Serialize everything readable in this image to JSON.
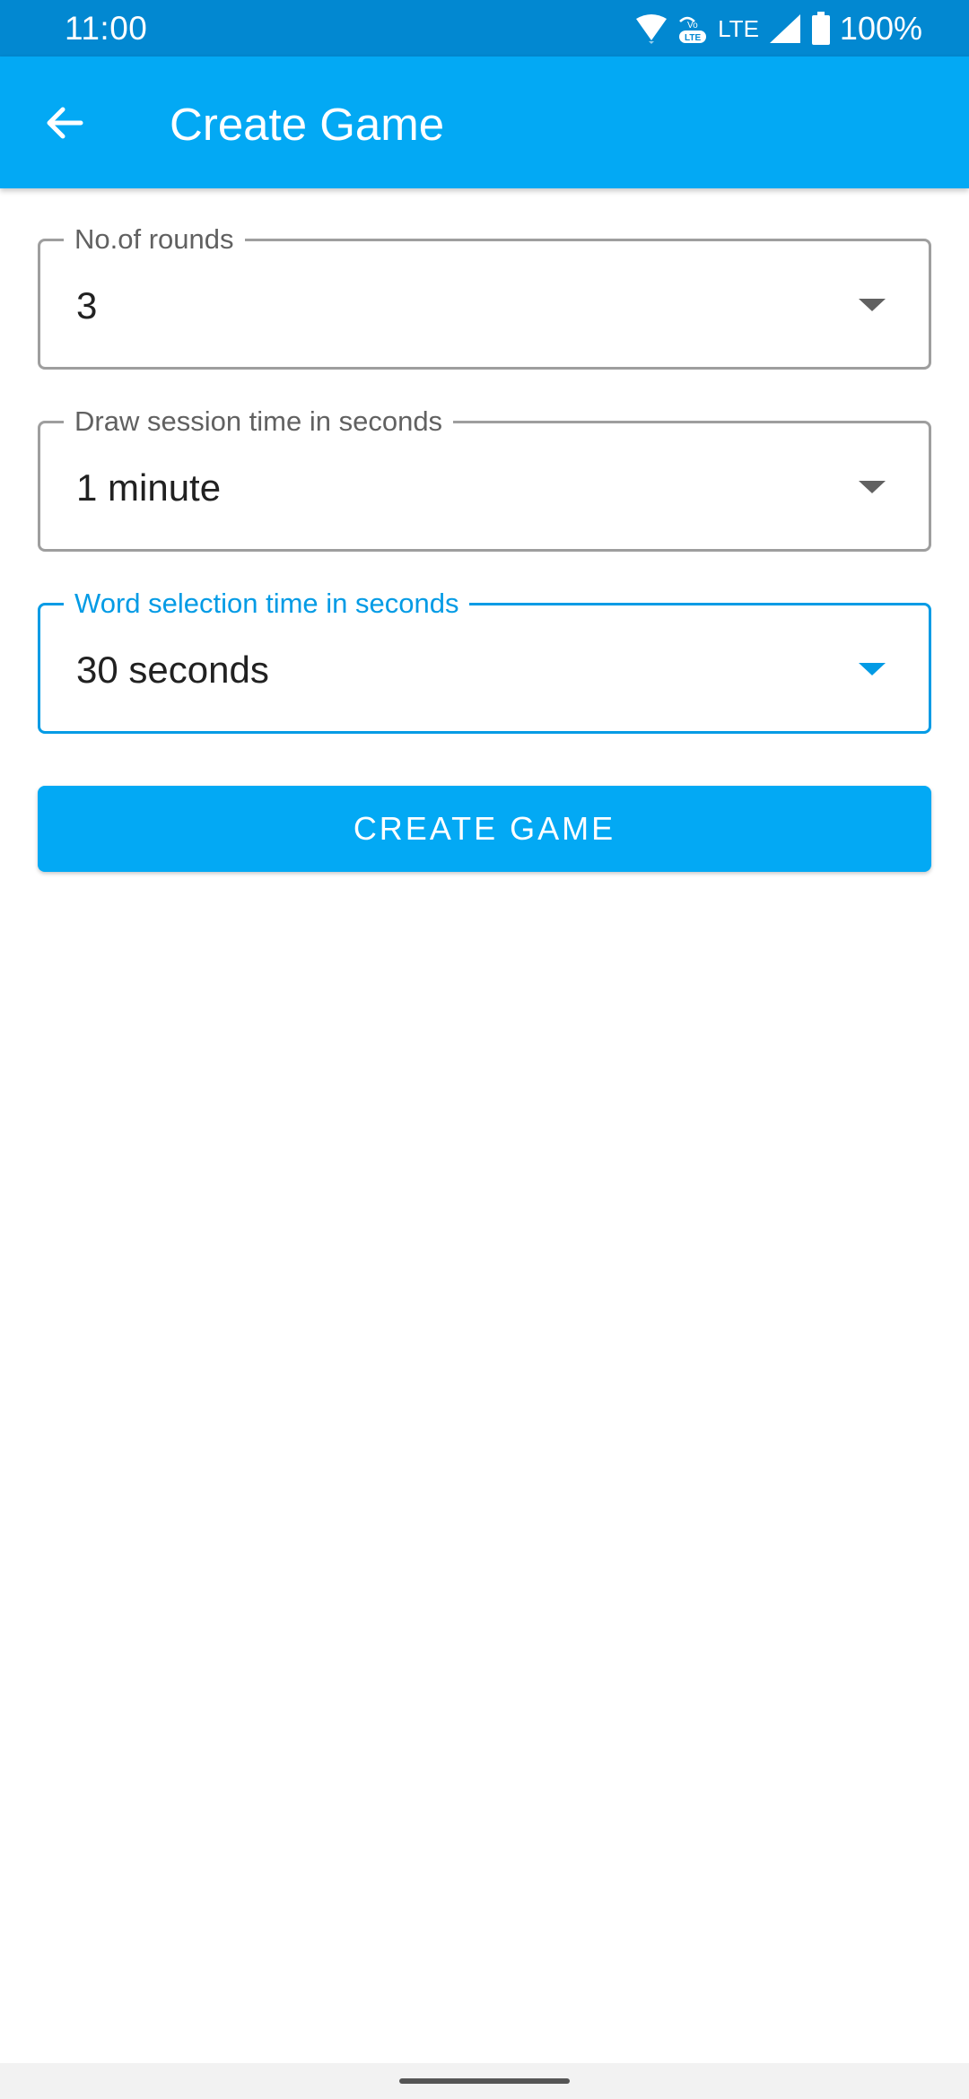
{
  "status_bar": {
    "time": "11:00",
    "lte_label": "LTE",
    "battery_percent": "100%",
    "icons": [
      "wifi-icon",
      "volte-icon",
      "signal-icon",
      "battery-icon"
    ]
  },
  "app_bar": {
    "title": "Create Game",
    "back_icon": "arrow-left-icon"
  },
  "form": {
    "rounds": {
      "label": "No.of rounds",
      "value": "3"
    },
    "draw_time": {
      "label": "Draw session time in seconds",
      "value": "1 minute"
    },
    "word_time": {
      "label": "Word selection time in seconds",
      "value": "30 seconds",
      "focused": true
    }
  },
  "actions": {
    "create_label": "CREATE GAME"
  },
  "colors": {
    "status_bar": "#0288d1",
    "app_bar": "#03a9f4",
    "accent": "#039be5",
    "outline": "#9e9e9e"
  }
}
